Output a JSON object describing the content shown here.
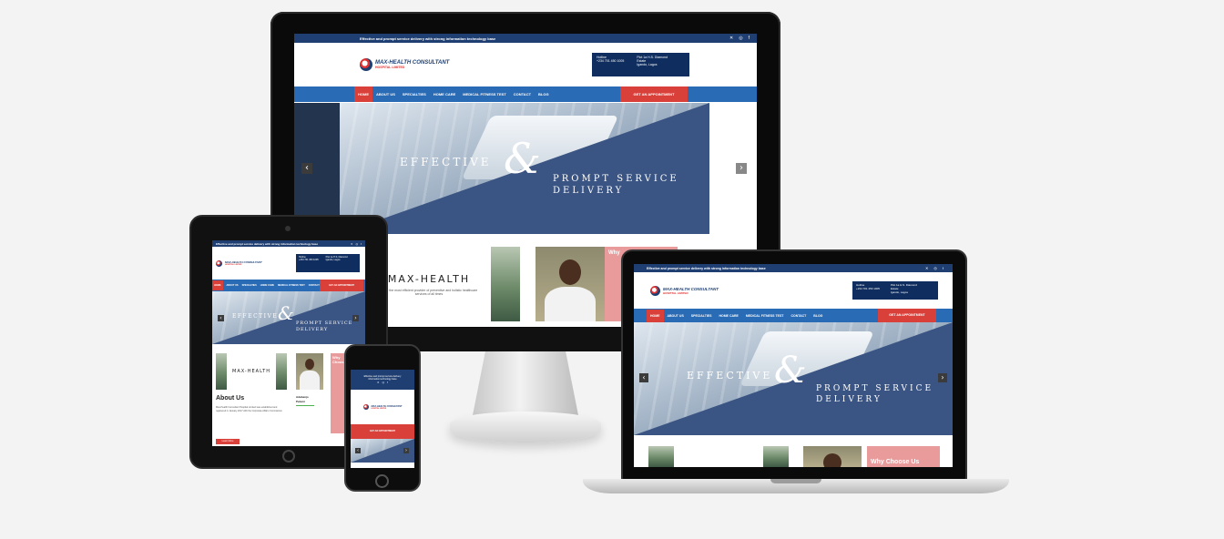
{
  "site": {
    "tagline": "Effective and prompt service delivery with strong information technology base",
    "tagline_phone_1": "Effective and prompt service delivery",
    "tagline_phone_2": "information technology base",
    "logo_name": "MAX-HEALTH CONSULTANT",
    "logo_sub": "HOSPITAL LIMITED",
    "hotline_label": "Hotline",
    "hotline_number": "+234 701 450 1005",
    "address_1": "Plot 1a H.S. Diamond",
    "address_2": "Estate",
    "address_3": "Igando, Lagos",
    "nav": [
      "HOME",
      "ABOUT US",
      "SPECIALTIES",
      "HOME CARE",
      "MEDICAL FITNESS TEST",
      "CONTACT",
      "BLOG"
    ],
    "appointment_btn": "GET AN APPOINTMENT",
    "hero_effective": "EFFECTIVE",
    "hero_amp": "&",
    "hero_prompt": "PROMPT SERVICE",
    "hero_delivery": "DELIVERY",
    "prev_arrow": "‹",
    "next_arrow": "›",
    "brand_card_title": "MAX-HEALTH",
    "brand_card_sub": "To be the most efficient provider of preventive and holistic healthcare services of all times",
    "why_label": "Why Choose Us",
    "why_short": "Why",
    "why_short_2": "Choos",
    "about_heading": "About Us",
    "about_text": "Max-Health Consultant Hospital Limited was established and registered in January 2017 with the Corporate Affairs Commission",
    "read_more": "Learn More",
    "doctor_name": "Adebanjo Pelumi",
    "doctor_name_1": "Adebanjo",
    "doctor_name_2": "Pelumi"
  },
  "colors": {
    "topbar": "#1f3f72",
    "nav": "#2a6bb5",
    "accent_red": "#d9403a",
    "hero_overlay": "#3a5483",
    "why_pink": "#e99a9b"
  },
  "icons": [
    "twitter-icon",
    "instagram-icon",
    "facebook-icon",
    "arrow-left-icon",
    "arrow-right-icon"
  ]
}
